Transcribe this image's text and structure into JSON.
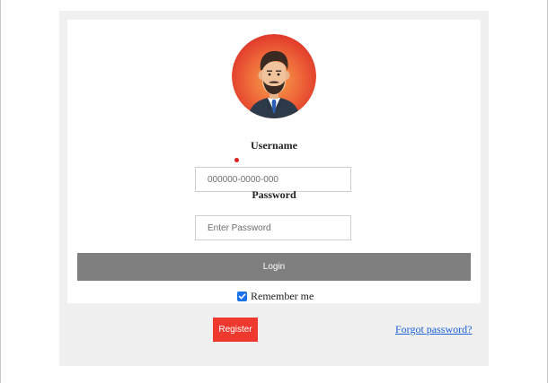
{
  "form": {
    "username_label": "Username",
    "username_placeholder": "000000-0000-000",
    "password_label": "Password",
    "password_placeholder": "Enter Password",
    "login_label": "Login",
    "remember_label": "Remember me",
    "remember_checked": true
  },
  "footer": {
    "register_label": "Register",
    "forgot_label": "Forgot password?"
  },
  "icons": {
    "avatar": "user-avatar-icon",
    "checkbox": "checkmark-icon"
  },
  "colors": {
    "avatar_bg": "#e8442c",
    "login_button": "#7f7f7f",
    "register_button": "#f0392e",
    "link": "#1a5fd6",
    "checkbox": "#1a73e8",
    "required_dot": "#e02020"
  }
}
